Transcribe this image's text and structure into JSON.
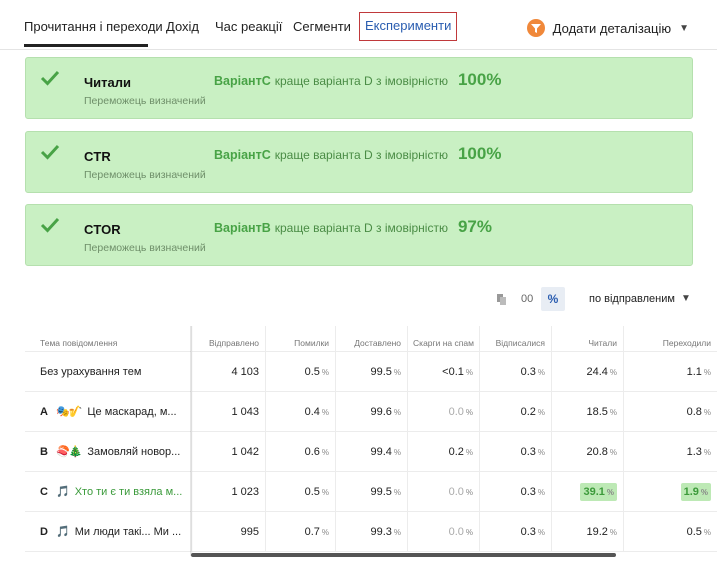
{
  "tabs": [
    "Прочитання і переходи",
    "Дохід",
    "Час реакції",
    "Сегменти",
    "Експерименти"
  ],
  "add_details_label": "Додати деталізацію",
  "experiments": [
    {
      "metric": "Читали",
      "winner_note": "Переможець визначений",
      "variant": "ВаріантC",
      "description": "краще варіанта D з імовірністю",
      "probability": "100%"
    },
    {
      "metric": "CTR",
      "winner_note": "Переможець визначений",
      "variant": "ВаріантC",
      "description": "краще варіанта D з імовірністю",
      "probability": "100%"
    },
    {
      "metric": "CTOR",
      "winner_note": "Переможець визначений",
      "variant": "ВаріантB",
      "description": "краще варіанта D з імовірністю",
      "probability": "97%"
    }
  ],
  "toolbar": {
    "format_00": "00",
    "format_pct": "%",
    "sort_label": "по відправленим"
  },
  "table": {
    "headers": [
      "Тема повідомлення",
      "Відправлено",
      "Помилки",
      "Доставлено",
      "Скарги на спам",
      "Відписалися",
      "Читали",
      "Переходили"
    ],
    "rows": [
      {
        "letter": "",
        "emoji": "",
        "name": "Без урахування тем",
        "sent": "4 103",
        "errors": "0.5",
        "delivered": "99.5",
        "spam": "<0.1",
        "unsub": "0.3",
        "read": "24.4",
        "clicks": "1.1"
      },
      {
        "letter": "A",
        "emoji": "🎭🎷",
        "name": "Це маскарад, м...",
        "sent": "1 043",
        "errors": "0.4",
        "delivered": "99.6",
        "spam": "0.0",
        "unsub": "0.2",
        "read": "18.5",
        "clicks": "0.8"
      },
      {
        "letter": "B",
        "emoji": "🍣🎄",
        "name": "Замовляй новор...",
        "sent": "1 042",
        "errors": "0.6",
        "delivered": "99.4",
        "spam": "0.2",
        "unsub": "0.3",
        "read": "20.8",
        "clicks": "1.3"
      },
      {
        "letter": "C",
        "emoji": "🎵",
        "name": "Хто ти є ти взяла м...",
        "sent": "1 023",
        "errors": "0.5",
        "delivered": "99.5",
        "spam": "0.0",
        "unsub": "0.3",
        "read": "39.1",
        "clicks": "1.9"
      },
      {
        "letter": "D",
        "emoji": "🎵",
        "name": "Ми люди такі... Ми ...",
        "sent": "995",
        "errors": "0.7",
        "delivered": "99.3",
        "spam": "0.0",
        "unsub": "0.3",
        "read": "19.2",
        "clicks": "0.5"
      }
    ],
    "percent_suffix": "%"
  },
  "colors": {
    "card_bg": "#c9f0c3",
    "winner_green": "#48a346",
    "active_tab": "#2a5db0",
    "highlight_border": "#c0393b"
  },
  "icons": [
    "checkmark-icon",
    "filter-icon",
    "chevron-down-icon",
    "copy-icon"
  ]
}
